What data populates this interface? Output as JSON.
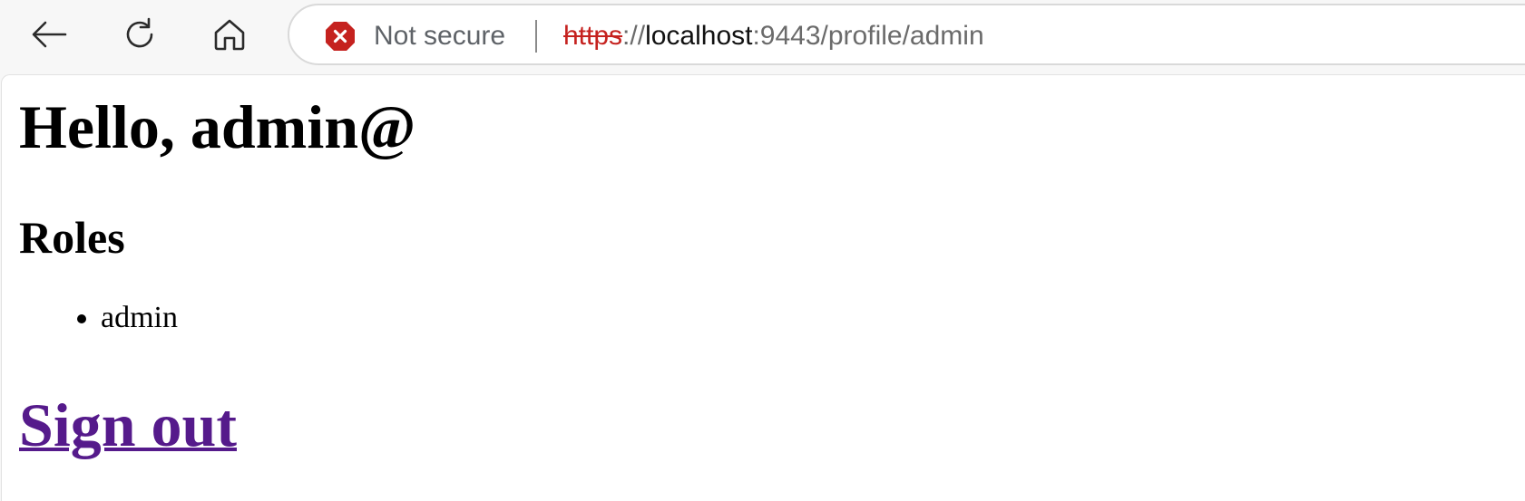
{
  "browser": {
    "security_label": "Not secure",
    "url": {
      "scheme": "https",
      "separator": "://",
      "host": "localhost",
      "rest": ":9443/profile/admin"
    },
    "icons": {
      "back": "arrow-left-icon",
      "reload": "reload-icon",
      "home": "home-icon",
      "security": "error-x-icon"
    },
    "colors": {
      "warning": "#c5221f",
      "text_muted": "#5f6368"
    }
  },
  "page": {
    "greeting": "Hello, admin@",
    "roles_heading": "Roles",
    "roles": [
      "admin"
    ],
    "signout_label": "Sign out",
    "colors": {
      "link_visited": "#551a8b"
    }
  }
}
